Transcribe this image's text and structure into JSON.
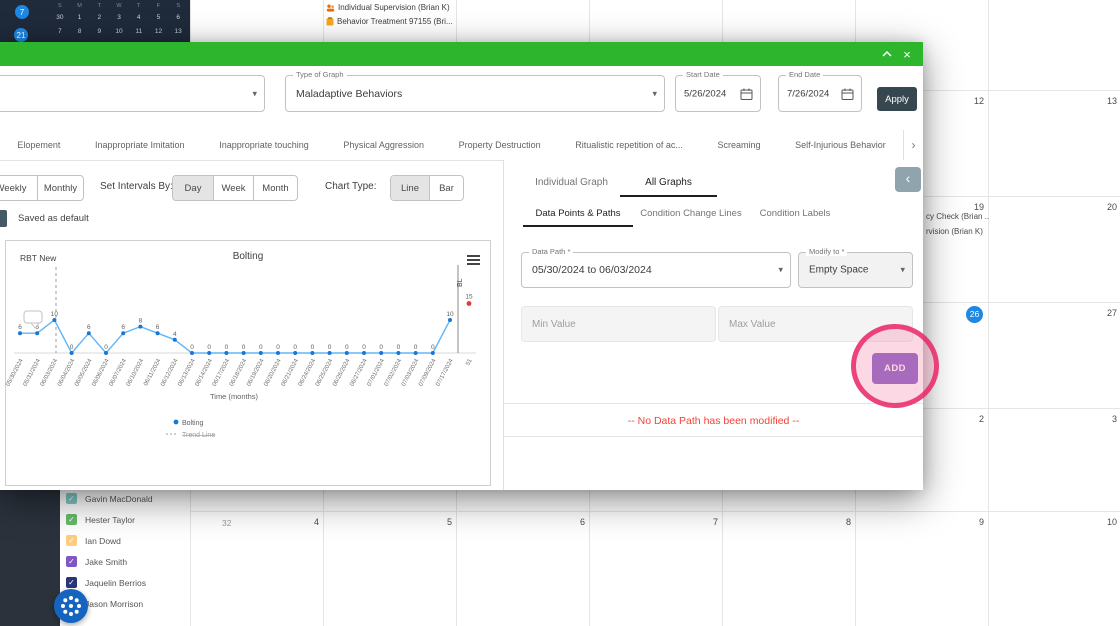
{
  "colors": {
    "header_green": "#2db52d",
    "apply_dark": "#37474f",
    "add_purple": "#7e57c2",
    "annotation_pink": "#e91e63",
    "error_red": "#f44336",
    "chart_line": "#64b5f6",
    "chart_point": "#1976d2",
    "baseline_red": "#e53935",
    "today_blue": "#1e88e5",
    "panel_collapse_gray": "#90a4ae"
  },
  "background": {
    "top_nav": {
      "badge_top": "7",
      "badge_bottom": "21",
      "mini_calendar": {
        "day_headers": [
          "S",
          "M",
          "T",
          "W",
          "T",
          "F",
          "S"
        ],
        "rows": [
          [
            "30",
            "1",
            "2",
            "3",
            "4",
            "5",
            "6"
          ],
          [
            "7",
            "8",
            "9",
            "10",
            "11",
            "12",
            "13"
          ]
        ]
      }
    },
    "agenda_events": [
      {
        "icon": "people-icon",
        "label": "Individual Supervision (Brian K)"
      },
      {
        "icon": "clipboard-icon",
        "label": "Behavior Treatment 97155 (Bri..."
      }
    ],
    "calendar": {
      "week_number": "32",
      "truncated_events": [
        "cy Check (Brian ..",
        "rvision (Brian K)"
      ],
      "date_cells": [
        {
          "row": 0,
          "col": 5,
          "label": "12"
        },
        {
          "row": 0,
          "col": 6,
          "label": "13"
        },
        {
          "row": 1,
          "col": 5,
          "label": "19"
        },
        {
          "row": 1,
          "col": 6,
          "label": "20"
        },
        {
          "row": 2,
          "col": 5,
          "label": "26",
          "today": true
        },
        {
          "row": 2,
          "col": 6,
          "label": "27"
        },
        {
          "row": 3,
          "col": 5,
          "label": "2"
        },
        {
          "row": 3,
          "col": 6,
          "label": "3"
        },
        {
          "row": 4,
          "col": 0,
          "label": "4"
        },
        {
          "row": 4,
          "col": 1,
          "label": "5"
        },
        {
          "row": 4,
          "col": 2,
          "label": "6"
        },
        {
          "row": 4,
          "col": 3,
          "label": "7"
        },
        {
          "row": 4,
          "col": 4,
          "label": "8"
        },
        {
          "row": 4,
          "col": 5,
          "label": "9"
        },
        {
          "row": 4,
          "col": 6,
          "label": "10"
        }
      ]
    },
    "client_list": [
      {
        "name": "Gavin MacDonald",
        "color": "#80cbc4"
      },
      {
        "name": "Hester Taylor",
        "color": "#66bb6a"
      },
      {
        "name": "Ian Dowd",
        "color": "#ffcc80"
      },
      {
        "name": "Jake Smith",
        "color": "#7e57c2"
      },
      {
        "name": "Jaquelin Berrios",
        "color": "#283578"
      },
      {
        "name": "Jason Morrison",
        "color": "#9575cd"
      }
    ]
  },
  "modal": {
    "filters": {
      "type_of_graph": {
        "label": "Type of Graph",
        "value": "Maladaptive Behaviors"
      },
      "start_date": {
        "label": "Start Date",
        "value": "5/26/2024"
      },
      "end_date": {
        "label": "End Date",
        "value": "7/26/2024"
      },
      "apply_label": "Apply"
    },
    "behavior_tabs": [
      "Elopement",
      "Inappropriate Imitation",
      "Inappropriate touching",
      "Physical Aggression",
      "Property Destruction",
      "Ritualistic repetition of ac...",
      "Screaming",
      "Self-Injurious Behavior"
    ],
    "view_controls": {
      "period_options": [
        "Weekly",
        "Monthly"
      ],
      "intervals_label": "Set Intervals By:",
      "interval_options": [
        "Day",
        "Week",
        "Month"
      ],
      "interval_selected": "Day",
      "chart_type_label": "Chart Type:",
      "chart_type_options": [
        "Line",
        "Bar"
      ],
      "chart_type_selected": "Line",
      "saved_default": "Saved as default"
    },
    "right_panel": {
      "tabs": [
        "Individual Graph",
        "All Graphs"
      ],
      "active_tab": "All Graphs",
      "sub_tabs": [
        "Data Points & Paths",
        "Condition Change Lines",
        "Condition Labels"
      ],
      "active_sub_tab": "Data Points & Paths",
      "data_path": {
        "label": "Data Path *",
        "value": "05/30/2024 to 06/03/2024"
      },
      "modify_to": {
        "label": "Modify to *",
        "value": "Empty Space"
      },
      "min_value_placeholder": "Min Value",
      "max_value_placeholder": "Max Value",
      "add_label": "ADD",
      "empty_message": "-- No Data Path has been modified --"
    }
  },
  "chart_data": {
    "type": "line",
    "title": "Bolting",
    "phase_label": "RBT New",
    "x": [
      "05/30/2024",
      "05/31/2024",
      "06/03/2024",
      "06/04/2024",
      "06/05/2024",
      "06/06/2024",
      "06/07/2024",
      "06/10/2024",
      "06/11/2024",
      "06/12/2024",
      "06/13/2024",
      "06/14/2024",
      "06/17/2024",
      "06/18/2024",
      "06/19/2024",
      "06/20/2024",
      "06/21/2024",
      "06/24/2024",
      "06/25/2024",
      "06/26/2024",
      "06/27/2024",
      "07/01/2024",
      "07/02/2024",
      "07/03/2024",
      "07/09/2024",
      "07/17/2024"
    ],
    "values": [
      6,
      6,
      10,
      0,
      6,
      0,
      6,
      8,
      6,
      4,
      0,
      0,
      0,
      0,
      0,
      0,
      0,
      0,
      0,
      0,
      0,
      0,
      0,
      0,
      0,
      10
    ],
    "baseline": {
      "label": "BL",
      "value": 15,
      "x_label": "51"
    },
    "xlabel": "Time (months)",
    "ylim": [
      0,
      20
    ],
    "grid": false,
    "legend": [
      "Bolting",
      "Trend Line"
    ],
    "legend_disabled": [
      "Trend Line"
    ],
    "legend_position": "bottom"
  }
}
